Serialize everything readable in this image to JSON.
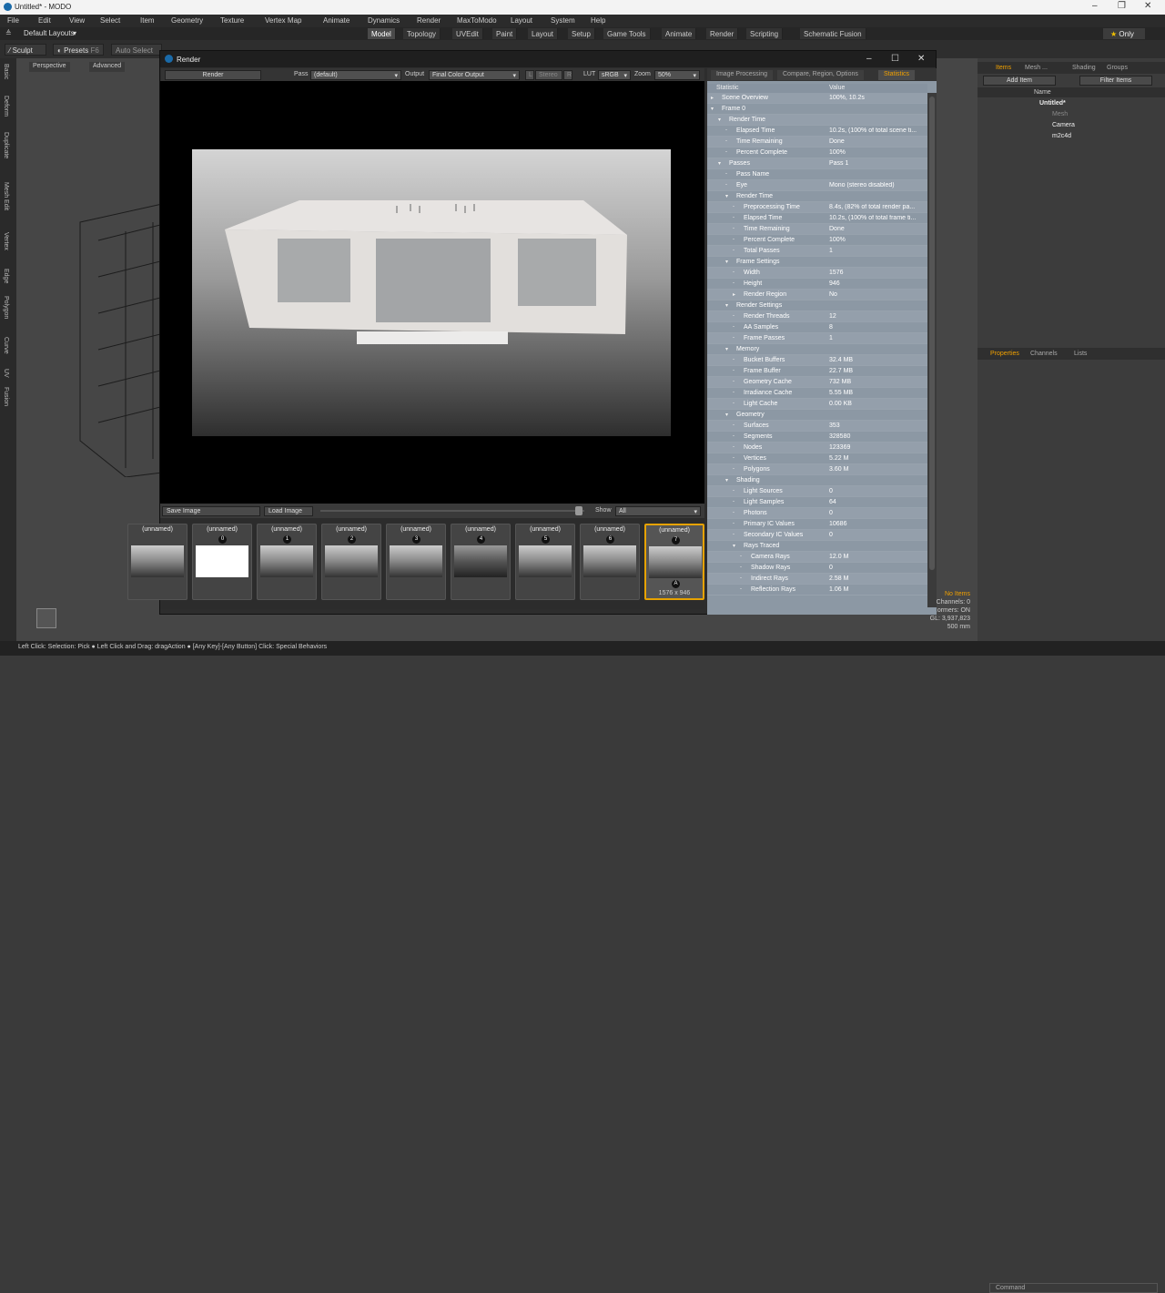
{
  "app": {
    "title": "Untitled* - MODO"
  },
  "menu": [
    "File",
    "Edit",
    "View",
    "Select",
    "Item",
    "Geometry",
    "Texture",
    "Vertex Map",
    "Animate",
    "Dynamics",
    "Render",
    "MaxToModo",
    "Layout",
    "System",
    "Help"
  ],
  "layouts": {
    "current": "Default Layouts",
    "tabs": [
      "Model",
      "Topology",
      "UVEdit",
      "Paint",
      "Layout",
      "Setup",
      "Game Tools",
      "Animate",
      "Render",
      "Scripting",
      "Schematic Fusion"
    ],
    "active": "Model",
    "only_label": "Only"
  },
  "toolbar": {
    "sculpt": "Sculpt",
    "presets": "Presets",
    "presets_key": "F6",
    "auto_select": "Auto Select"
  },
  "viewport": {
    "tabs": [
      "Perspective",
      "Advanced"
    ]
  },
  "left_strip": [
    "Basic",
    "Deform",
    "Duplicate",
    "Mesh Edit",
    "Vertex",
    "Edge",
    "Polygon",
    "Curve",
    "UV",
    "Fusion"
  ],
  "render_window": {
    "title": "Render",
    "render_button": "Render",
    "pass_label": "Pass",
    "pass_value": "(default)",
    "output_label": "Output",
    "output_value": "Final Color Output",
    "stereo_label": "L",
    "stereo_value": "Stereo",
    "r_label": "R",
    "lut_label": "LUT",
    "lut_value": "sRGB",
    "zoom_label": "Zoom",
    "zoom_value": "50%",
    "save_image": "Save Image",
    "load_image": "Load Image",
    "show_label": "Show",
    "show_value": "All"
  },
  "thumbnails": [
    {
      "label": "(unnamed)",
      "num": ""
    },
    {
      "label": "(unnamed)",
      "num": "0"
    },
    {
      "label": "(unnamed)",
      "num": "1"
    },
    {
      "label": "(unnamed)",
      "num": "2"
    },
    {
      "label": "(unnamed)",
      "num": "3"
    },
    {
      "label": "(unnamed)",
      "num": "4"
    },
    {
      "label": "(unnamed)",
      "num": "5"
    },
    {
      "label": "(unnamed)",
      "num": "6"
    },
    {
      "label": "(unnamed)",
      "num": "7",
      "sub": "A",
      "size": "1576 x 946"
    }
  ],
  "stats_panel": {
    "tabs": [
      "Image Processing",
      "Compare, Region, Options",
      "Statistics"
    ],
    "active_tab": "Statistics",
    "col_statistic": "Statistic",
    "col_value": "Value",
    "rows": [
      {
        "name": "Scene Overview",
        "value": "100%, 10.2s",
        "level": 0,
        "arrow": "▸"
      },
      {
        "name": "Frame 0",
        "value": "",
        "level": 0,
        "arrow": "▾"
      },
      {
        "name": "Render Time",
        "value": "",
        "level": 1,
        "arrow": "▾"
      },
      {
        "name": "Elapsed Time",
        "value": "10.2s, (100% of total scene ti...",
        "level": 2,
        "arrow": "-"
      },
      {
        "name": "Time Remaining",
        "value": "Done",
        "level": 2,
        "arrow": "-"
      },
      {
        "name": "Percent Complete",
        "value": "100%",
        "level": 2,
        "arrow": "-"
      },
      {
        "name": "Passes",
        "value": "Pass 1",
        "level": 1,
        "arrow": "▾"
      },
      {
        "name": "Pass Name",
        "value": "",
        "level": 2,
        "arrow": "-"
      },
      {
        "name": "Eye",
        "value": "Mono (stereo disabled)",
        "level": 2,
        "arrow": "-"
      },
      {
        "name": "Render Time",
        "value": "",
        "level": 2,
        "arrow": "▾"
      },
      {
        "name": "Preprocessing Time",
        "value": "8.4s, (82% of total render pa...",
        "level": 3,
        "arrow": "-"
      },
      {
        "name": "Elapsed Time",
        "value": "10.2s, (100% of total frame ti...",
        "level": 3,
        "arrow": "-"
      },
      {
        "name": "Time Remaining",
        "value": "Done",
        "level": 3,
        "arrow": "-"
      },
      {
        "name": "Percent Complete",
        "value": "100%",
        "level": 3,
        "arrow": "-"
      },
      {
        "name": "Total Passes",
        "value": "1",
        "level": 3,
        "arrow": "-"
      },
      {
        "name": "Frame Settings",
        "value": "",
        "level": 2,
        "arrow": "▾"
      },
      {
        "name": "Width",
        "value": "1576",
        "level": 3,
        "arrow": "-"
      },
      {
        "name": "Height",
        "value": "946",
        "level": 3,
        "arrow": "-"
      },
      {
        "name": "Render Region",
        "value": "No",
        "level": 3,
        "arrow": "▸"
      },
      {
        "name": "Render Settings",
        "value": "",
        "level": 2,
        "arrow": "▾"
      },
      {
        "name": "Render Threads",
        "value": "12",
        "level": 3,
        "arrow": "-"
      },
      {
        "name": "AA Samples",
        "value": "8",
        "level": 3,
        "arrow": "-"
      },
      {
        "name": "Frame Passes",
        "value": "1",
        "level": 3,
        "arrow": "-"
      },
      {
        "name": "Memory",
        "value": "",
        "level": 2,
        "arrow": "▾"
      },
      {
        "name": "Bucket Buffers",
        "value": "32.4 MB",
        "level": 3,
        "arrow": "-"
      },
      {
        "name": "Frame Buffer",
        "value": "22.7 MB",
        "level": 3,
        "arrow": "-"
      },
      {
        "name": "Geometry Cache",
        "value": "732 MB",
        "level": 3,
        "arrow": "-"
      },
      {
        "name": "Irradiance Cache",
        "value": "5.55 MB",
        "level": 3,
        "arrow": "-"
      },
      {
        "name": "Light Cache",
        "value": "0.00 KB",
        "level": 3,
        "arrow": "-"
      },
      {
        "name": "Geometry",
        "value": "",
        "level": 2,
        "arrow": "▾"
      },
      {
        "name": "Surfaces",
        "value": "353",
        "level": 3,
        "arrow": "-"
      },
      {
        "name": "Segments",
        "value": "328580",
        "level": 3,
        "arrow": "-"
      },
      {
        "name": "Nodes",
        "value": "123369",
        "level": 3,
        "arrow": "-"
      },
      {
        "name": "Vertices",
        "value": "5.22 M",
        "level": 3,
        "arrow": "-"
      },
      {
        "name": "Polygons",
        "value": "3.60 M",
        "level": 3,
        "arrow": "-"
      },
      {
        "name": "Shading",
        "value": "",
        "level": 2,
        "arrow": "▾"
      },
      {
        "name": "Light Sources",
        "value": "0",
        "level": 3,
        "arrow": "-"
      },
      {
        "name": "Light Samples",
        "value": "64",
        "level": 3,
        "arrow": "-"
      },
      {
        "name": "Photons",
        "value": "0",
        "level": 3,
        "arrow": "-"
      },
      {
        "name": "Primary IC Values",
        "value": "10686",
        "level": 3,
        "arrow": "-"
      },
      {
        "name": "Secondary IC Values",
        "value": "0",
        "level": 3,
        "arrow": "-"
      },
      {
        "name": "Rays Traced",
        "value": "",
        "level": 3,
        "arrow": "▾"
      },
      {
        "name": "Camera Rays",
        "value": "12.0 M",
        "level": 4,
        "arrow": "-"
      },
      {
        "name": "Shadow Rays",
        "value": "0",
        "level": 4,
        "arrow": "-"
      },
      {
        "name": "Indirect Rays",
        "value": "2.58 M",
        "level": 4,
        "arrow": "-"
      },
      {
        "name": "Reflection Rays",
        "value": "1.06 M",
        "level": 4,
        "arrow": "-"
      }
    ]
  },
  "items_panel": {
    "tabs": [
      "Items",
      "Mesh ...",
      "Shading",
      "Groups"
    ],
    "add_item": "Add Item",
    "filter_items": "Filter Items",
    "col_name": "Name",
    "tree": [
      "Untitled*",
      "Mesh",
      "Camera",
      "m2c4d"
    ]
  },
  "props_panel": {
    "tabs": [
      "Properties",
      "Channels",
      "Lists"
    ]
  },
  "info": {
    "no_items": "No Items",
    "channels": "Channels: 0",
    "deformers": "...ormers: ON",
    "gl": "GL: 3,937,823",
    "size": "500 mm"
  },
  "status": {
    "text": "Left Click: Selection: Pick ● Left Click and Drag: dragAction ● [Any Key]-[Any Button] Click: Special Behaviors",
    "command_placeholder": "Command"
  }
}
